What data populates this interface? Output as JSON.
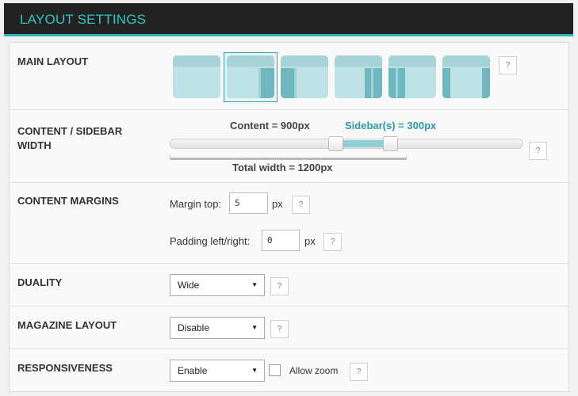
{
  "header": {
    "title": "LAYOUT SETTINGS"
  },
  "main_layout": {
    "label": "MAIN LAYOUT",
    "help": "?",
    "options": [
      {
        "name": "full-width",
        "selected": false
      },
      {
        "name": "right-sidebar",
        "selected": true
      },
      {
        "name": "left-sidebar",
        "selected": false
      },
      {
        "name": "two-right-sidebars",
        "selected": false
      },
      {
        "name": "two-left-sidebars",
        "selected": false
      },
      {
        "name": "sidebars-both-sides",
        "selected": false
      }
    ]
  },
  "content_width": {
    "label_line1": "CONTENT / SIDEBAR",
    "label_line2": "WIDTH",
    "content_text": "Content = 900px",
    "sidebar_text": "Sidebar(s) = 300px",
    "total_text": "Total width = 1200px",
    "help": "?"
  },
  "margins": {
    "label": "CONTENT MARGINS",
    "margin_top_label": "Margin top:",
    "margin_top_value": "5",
    "padding_label": "Padding left/right:",
    "padding_value": "0",
    "unit": "px",
    "help": "?"
  },
  "duality": {
    "label": "DUALITY",
    "value": "Wide",
    "help": "?"
  },
  "magazine": {
    "label": "MAGAZINE LAYOUT",
    "value": "Disable",
    "help": "?"
  },
  "responsive": {
    "label": "RESPONSIVENESS",
    "value": "Enable",
    "allow_zoom_label": "Allow zoom",
    "help": "?"
  },
  "colors": {
    "accent": "#2ab7b7",
    "sidebar_text": "#2a9aa6",
    "header_bg": "#222222"
  },
  "icons": {
    "select_arrow": "▼"
  }
}
